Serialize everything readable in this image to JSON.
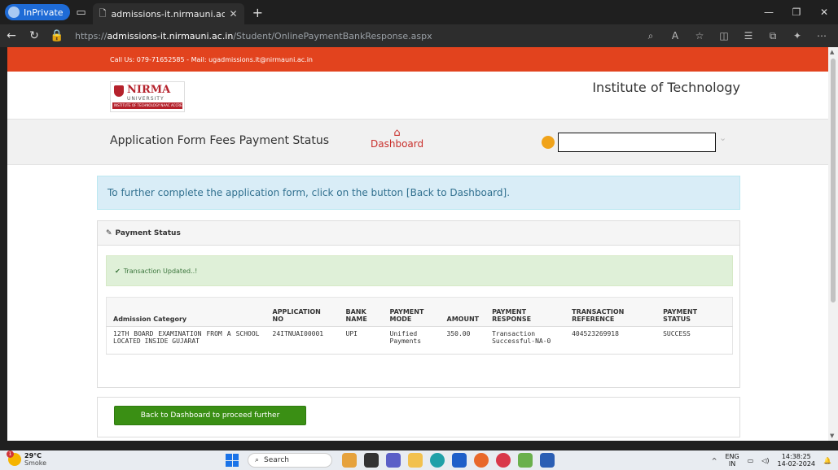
{
  "browser": {
    "inprivate_label": "InPrivate",
    "tab_title": "admissions-it.nirmauni.ac.in/Stud",
    "url_prefix": "https://",
    "url_host": "admissions-it.nirmauni.ac.in",
    "url_path": "/Student/OnlinePaymentBankResponse.aspx"
  },
  "site": {
    "contact": "Call Us: 079-71652585 - Mail: ugadmissions.it@nirmauni.ac.in",
    "logo_name": "NIRMA",
    "logo_sub": "UNIVERSITY",
    "logo_band": "INSTITUTE OF TECHNOLOGY NAAC ACCREDITED 'A+' GRADE",
    "institute": "Institute of Technology",
    "page_title": "Application Form Fees Payment Status",
    "dashboard_label": "Dashboard"
  },
  "info_message": "To further complete the application form, click on the button [Back to Dashboard].",
  "panel": {
    "title": "Payment Status",
    "alert": "Transaction Updated..!"
  },
  "table": {
    "headers": [
      "Admission Category",
      "APPLICATION NO",
      "BANK NAME",
      "PAYMENT MODE",
      "AMOUNT",
      "PAYMENT RESPONSE",
      "TRANSACTION REFERENCE",
      "PAYMENT STATUS"
    ],
    "rows": [
      [
        "12TH BOARD EXAMINATION FROM A SCHOOL LOCATED INSIDE GUJARAT",
        "24ITNUAI00001",
        "UPI",
        "Unified Payments",
        "350.00",
        "Transaction Successful-NA-0",
        "404523269918",
        "SUCCESS"
      ]
    ]
  },
  "back_button": "Back to Dashboard to proceed further",
  "taskbar": {
    "weather_badge": "1",
    "temp": "29°C",
    "condition": "Smoke",
    "search": "Search",
    "lang1": "ENG",
    "lang2": "IN",
    "time": "14:38:25",
    "date": "14-02-2024"
  },
  "colors": {
    "topstrip": "#e2431e",
    "button": "#3a8f14",
    "info_bg": "#d9edf7",
    "success_bg": "#dff0d8"
  }
}
